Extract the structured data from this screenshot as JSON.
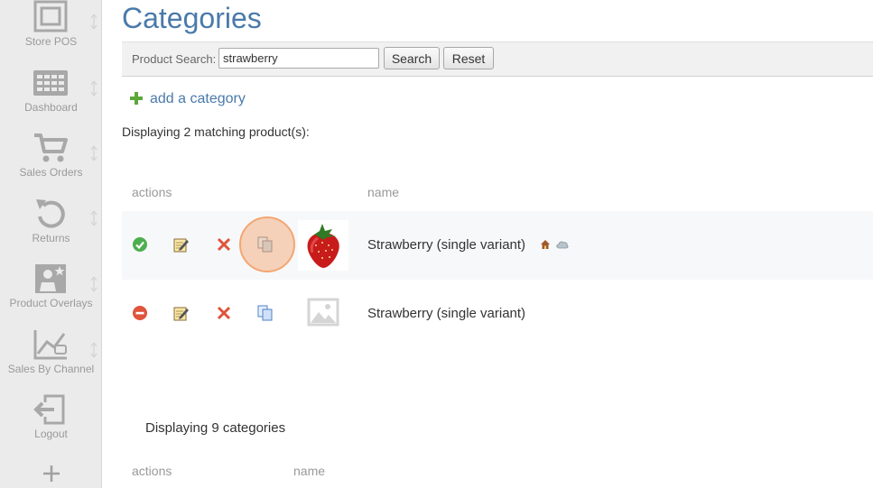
{
  "sidebar": {
    "items": [
      {
        "label": "Store POS",
        "icon": "store-pos-icon"
      },
      {
        "label": "Dashboard",
        "icon": "dashboard-icon"
      },
      {
        "label": "Sales Orders",
        "icon": "cart-icon"
      },
      {
        "label": "Returns",
        "icon": "returns-icon"
      },
      {
        "label": "Product Overlays",
        "icon": "product-overlay-icon"
      },
      {
        "label": "Sales By Channel",
        "icon": "sales-chart-icon"
      },
      {
        "label": "Logout",
        "icon": "logout-icon"
      }
    ],
    "more_icon": "plus-icon"
  },
  "page": {
    "title": "Categories"
  },
  "search": {
    "label": "Product Search:",
    "value": "strawberry",
    "search_label": "Search",
    "reset_label": "Reset"
  },
  "add_category": {
    "label": "add a category",
    "icon": "plus-icon"
  },
  "products": {
    "count_text": "Displaying 2 matching product(s):",
    "columns": {
      "actions": "actions",
      "name": "name"
    },
    "rows": [
      {
        "status_icon": "check-circle-icon",
        "name": "Strawberry (single variant)",
        "has_image": true,
        "extra_icons": [
          "home-icon",
          "cloud-icon"
        ]
      },
      {
        "status_icon": "minus-circle-icon",
        "name": "Strawberry (single variant)",
        "has_image": false,
        "extra_icons": []
      }
    ]
  },
  "categories": {
    "count_text": "Displaying 9 categories",
    "columns": {
      "actions": "actions",
      "name": "name"
    }
  },
  "colors": {
    "accent": "#4a7aaa",
    "success": "#4caf50",
    "danger": "#e0543c",
    "hover_ring": "#f3a673",
    "sidebar_bg": "#ebebeb"
  }
}
